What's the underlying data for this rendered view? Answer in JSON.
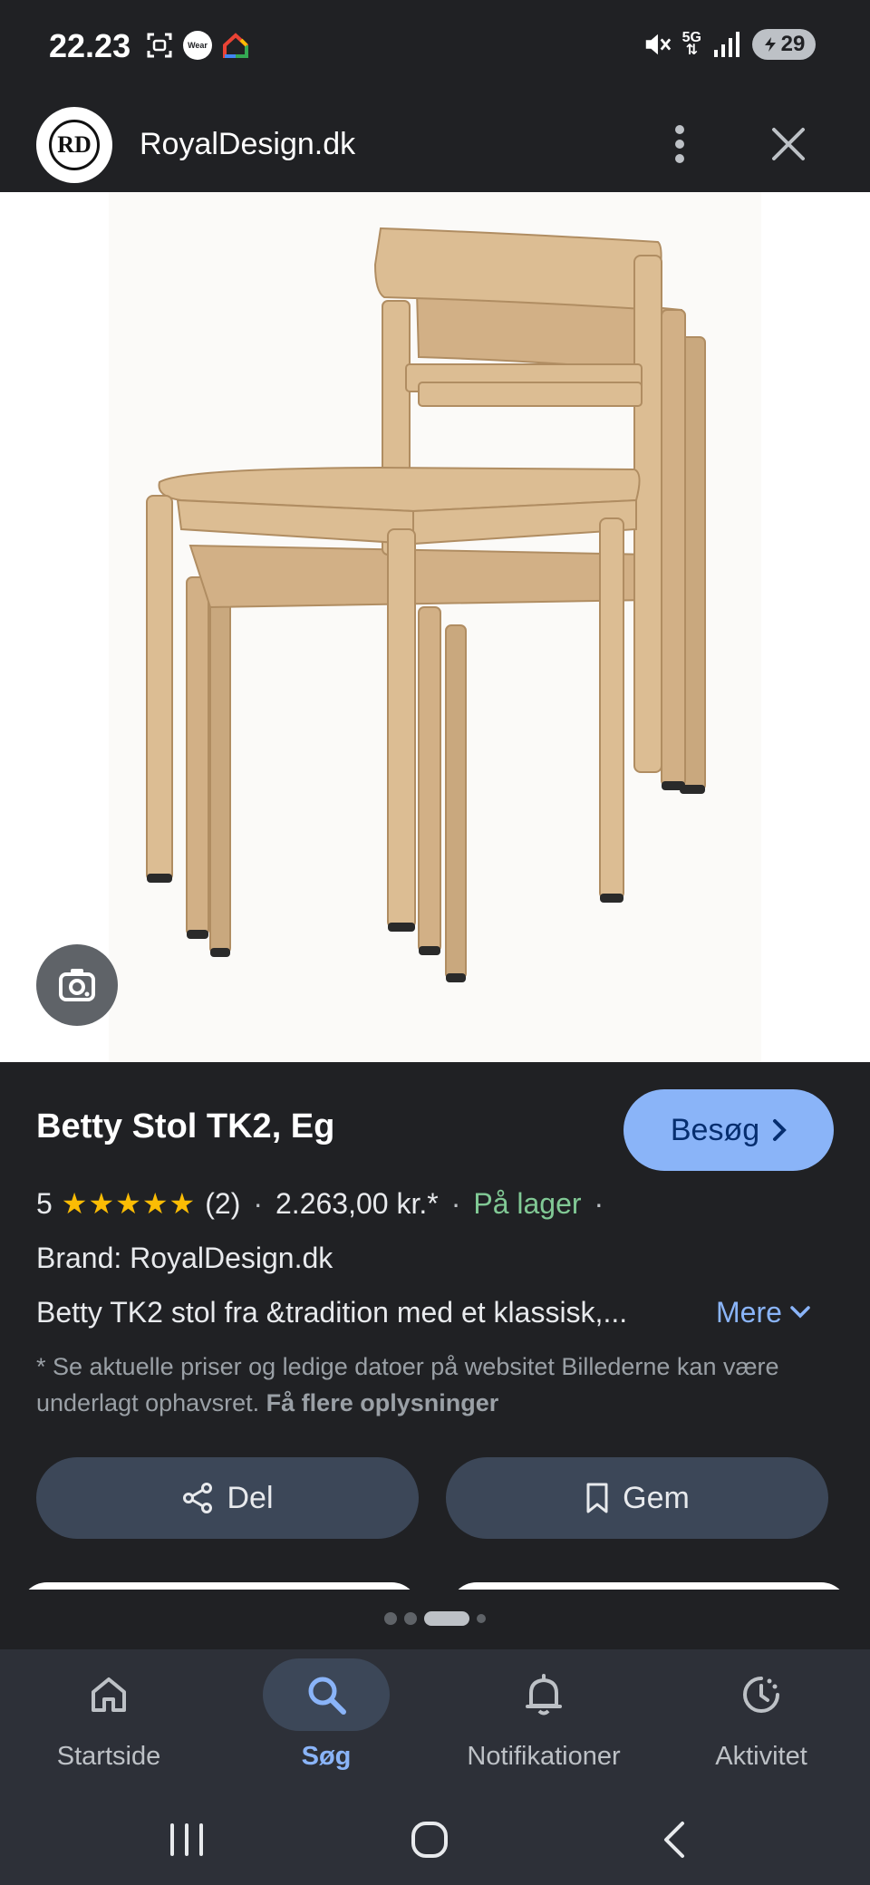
{
  "status_bar": {
    "time": "22.23",
    "wear_label": "Wear",
    "network": "5G",
    "battery": "29"
  },
  "site": {
    "logo_text": "RD",
    "name": "RoyalDesign.dk"
  },
  "product": {
    "title": "Betty Stol TK2, Eg",
    "visit_label": "Besøg",
    "rating_value": "5",
    "stars": "★★★★★",
    "rating_count": "(2)",
    "price": "2.263,00 kr.*",
    "stock": "På lager",
    "brand": "Brand: RoyalDesign.dk",
    "description": "Betty TK2 stol fra &tradition med et klassisk,...",
    "more_label": "Mere",
    "disclaimer": "* Se aktuelle priser og ledige datoer på websitet Billederne kan være underlagt ophavsret. ",
    "disclaimer_link": "Få flere oplysninger"
  },
  "actions": {
    "share_label": "Del",
    "save_label": "Gem"
  },
  "pager": {
    "count": 4,
    "active_index": 2
  },
  "bottom_nav": {
    "items": [
      {
        "label": "Startside",
        "icon": "home-icon"
      },
      {
        "label": "Søg",
        "icon": "search-icon",
        "active": true
      },
      {
        "label": "Notifikationer",
        "icon": "bell-icon"
      },
      {
        "label": "Aktivitet",
        "icon": "activity-icon"
      }
    ]
  },
  "colors": {
    "background": "#202124",
    "accent": "#8ab4f8",
    "stock_green": "#81c995",
    "star_yellow": "#fbbc04",
    "button_fill": "#3c4758"
  }
}
